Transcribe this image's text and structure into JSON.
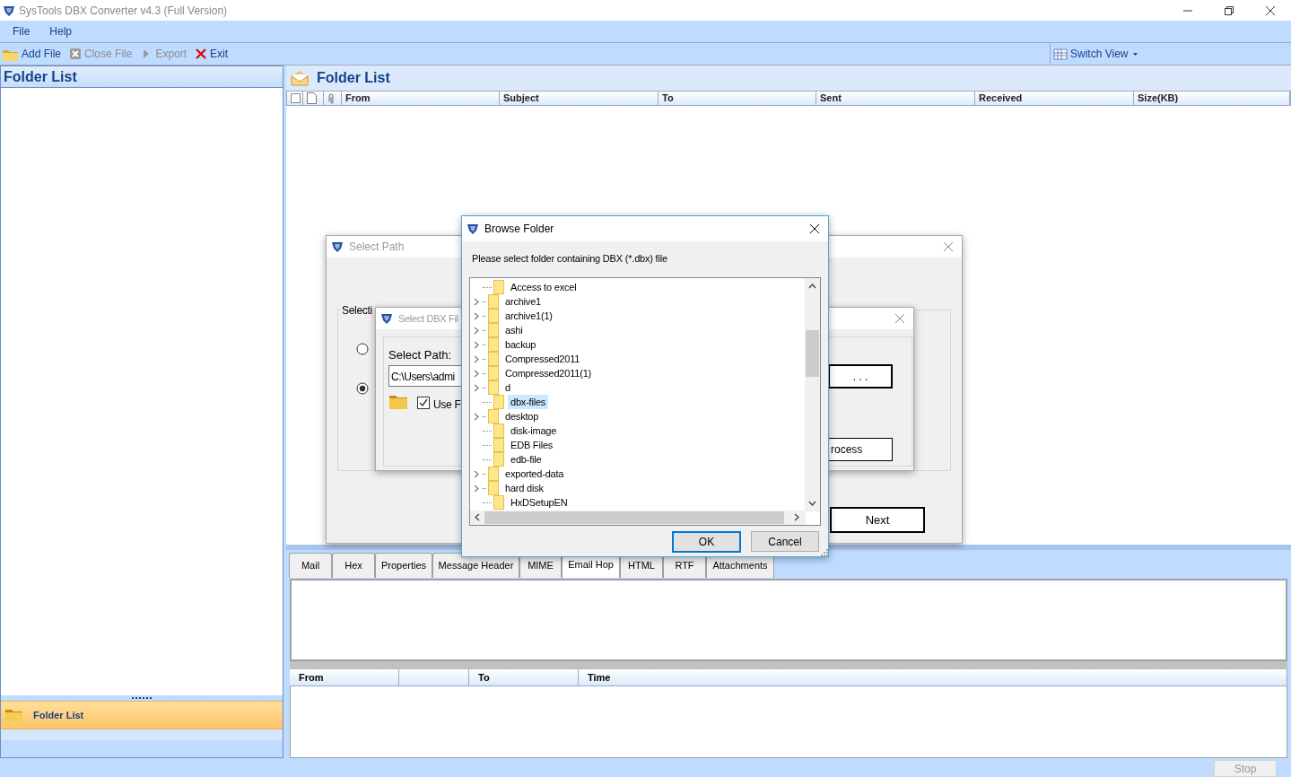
{
  "window": {
    "title": "SysTools DBX Converter v4.3 (Full Version)"
  },
  "menu": [
    "File",
    "Help"
  ],
  "toolbar": [
    {
      "label": "Add File",
      "kind": "add",
      "disabled": false
    },
    {
      "label": "Close File",
      "kind": "close",
      "disabled": true
    },
    {
      "label": "Export",
      "kind": "export",
      "disabled": true
    },
    {
      "label": "Exit",
      "kind": "exit",
      "disabled": false
    }
  ],
  "switch_view": "Switch View",
  "folder_panel": {
    "title": "Folder List",
    "nav_button": "Folder List"
  },
  "mail_list": {
    "title": "Folder List",
    "columns": [
      "From",
      "Subject",
      "To",
      "Sent",
      "Received",
      "Size(KB)"
    ]
  },
  "preview_tabs": [
    {
      "label": "Mail",
      "selected": false
    },
    {
      "label": "Hex",
      "selected": false
    },
    {
      "label": "Properties",
      "selected": false
    },
    {
      "label": "Message Header",
      "selected": false
    },
    {
      "label": "MIME",
      "selected": false
    },
    {
      "label": "Email Hop",
      "selected": true
    },
    {
      "label": "HTML",
      "selected": false
    },
    {
      "label": "RTF",
      "selected": false
    },
    {
      "label": "Attachments",
      "selected": false
    }
  ],
  "hop_table": {
    "columns": [
      "From",
      "To",
      "Time"
    ]
  },
  "status_bar": {
    "stop_button": "Stop"
  },
  "select_path_dialog": {
    "title": "Select Path",
    "active": false,
    "group_label": "Selecti",
    "options": [
      {
        "selected": false
      },
      {
        "selected": true
      }
    ],
    "next_button": "Next"
  },
  "select_dbx_dialog": {
    "title": "Select DBX Fil",
    "active": false,
    "path_label": "Select Path:",
    "path_value": "C:\\Users\\admi",
    "use_folder": {
      "label": "Use F",
      "checked": true
    },
    "browse_button": ". . .",
    "process_button": "rocess"
  },
  "browse_folder_dialog": {
    "title": "Browse Folder",
    "active": true,
    "prompt": "Please select folder containing DBX (*.dbx) file",
    "folders": [
      {
        "label": "Access to excel",
        "expandable": false,
        "selected": false
      },
      {
        "label": "archive1",
        "expandable": true,
        "selected": false
      },
      {
        "label": "archive1(1)",
        "expandable": true,
        "selected": false
      },
      {
        "label": "ashi",
        "expandable": true,
        "selected": false
      },
      {
        "label": "backup",
        "expandable": true,
        "selected": false
      },
      {
        "label": "Compressed2011",
        "expandable": true,
        "selected": false
      },
      {
        "label": "Compressed2011(1)",
        "expandable": true,
        "selected": false
      },
      {
        "label": "d",
        "expandable": true,
        "selected": false
      },
      {
        "label": "dbx-files",
        "expandable": false,
        "selected": true
      },
      {
        "label": "desktop",
        "expandable": true,
        "selected": false
      },
      {
        "label": "disk-image",
        "expandable": false,
        "selected": false
      },
      {
        "label": "EDB Files",
        "expandable": false,
        "selected": false
      },
      {
        "label": "edb-file",
        "expandable": false,
        "selected": false
      },
      {
        "label": "exported-data",
        "expandable": true,
        "selected": false
      },
      {
        "label": "hard disk",
        "expandable": true,
        "selected": false
      },
      {
        "label": "HxDSetupEN",
        "expandable": false,
        "selected": false
      }
    ],
    "ok_button": "OK",
    "cancel_button": "Cancel"
  }
}
